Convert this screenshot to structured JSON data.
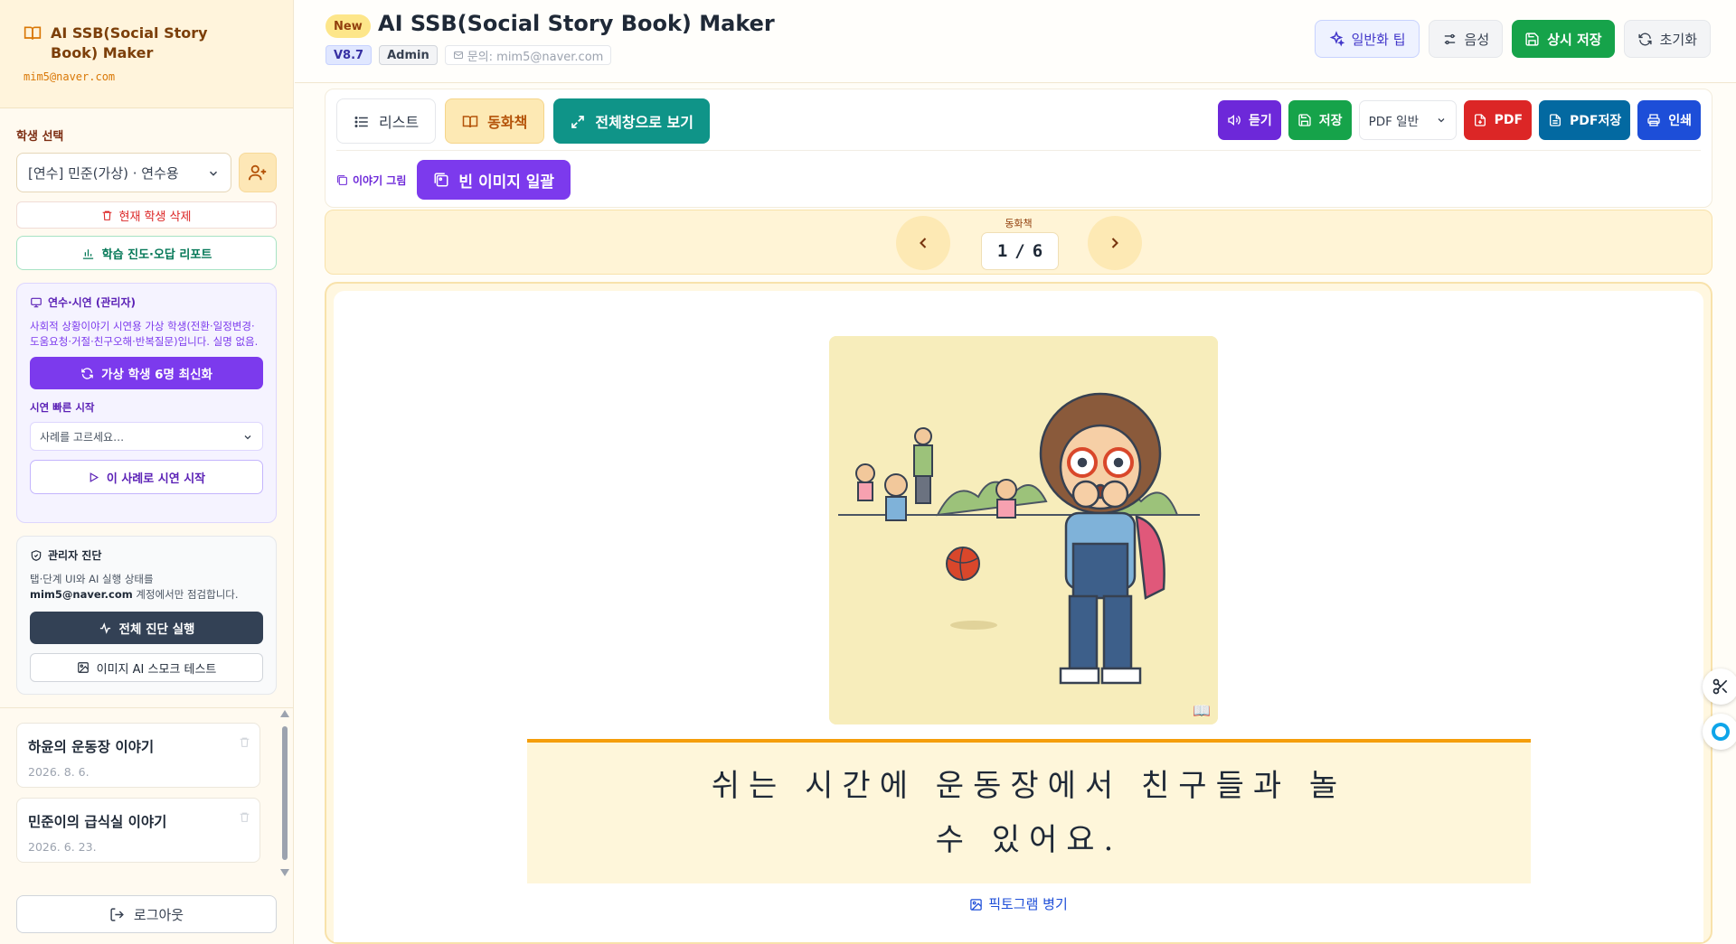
{
  "brand": {
    "title": "AI SSB(Social Story Book) Maker",
    "email": "mim5@naver.com"
  },
  "sidebar": {
    "student_label": "학생 선택",
    "student_selected": "[연수] 민준(가상) · 연수용",
    "delete_student": "현재 학생 삭제",
    "report_button": "학습 진도·오답 리포트",
    "demo_card": {
      "title": "연수·시연 (관리자)",
      "desc": "사회적 상황이야기 시연용 가상 학생(전환·일정변경·도움요청·거절·친구오해·반복질문)입니다. 실명 없음.",
      "refresh_button": "가상 학생 6명 최신화",
      "quick_label": "시연 빠른 시작",
      "case_placeholder": "사례를 고르세요…",
      "start_button": "이 사례로 시연 시작"
    },
    "admin_card": {
      "title": "관리자 진단",
      "desc_prefix": "탭·단계 UI와 AI 실행 상태를",
      "desc_email": "mim5@naver.com",
      "desc_suffix": " 계정에서만 점검합니다.",
      "run_button": "전체 진단 실행",
      "smoke_button": "이미지 AI 스모크 테스트"
    },
    "stories": [
      {
        "title": "하윤의 운동장 이야기",
        "date": "2026. 8. 6."
      },
      {
        "title": "민준이의 급식실 이야기",
        "date": "2026. 6. 23."
      }
    ],
    "logout": "로그아웃"
  },
  "header": {
    "badge": "New",
    "title": "AI SSB(Social Story Book) Maker",
    "version": "V8.7",
    "role": "Admin",
    "contact": "문의: mim5@naver.com",
    "actions": {
      "tip": "일반화 팁",
      "voice": "음성",
      "save": "상시 저장",
      "reset": "초기화"
    }
  },
  "toolbar": {
    "list": "리스트",
    "book": "동화책",
    "fullscreen": "전체창으로 보기",
    "listen": "듣기",
    "save": "저장",
    "pdf_mode": "PDF 일반",
    "pdf": "PDF",
    "pdf_save": "PDF저장",
    "print": "인쇄",
    "story_image_label": "이야기 그림",
    "blank_images": "빈 이미지 일괄"
  },
  "pager": {
    "caption": "동화책",
    "current": "1",
    "separator": "/",
    "total": "6"
  },
  "page": {
    "caption": "쉬는 시간에 운동장에서 친구들과 놀 수 있어요.",
    "pictogram_toggle": "픽토그램 병기"
  },
  "colors": {
    "accent_purple": "#7c3aed",
    "save_green": "#16a34a",
    "teal": "#0f9488",
    "pdf_red": "#dc2626",
    "amber": "#f59e0b"
  }
}
